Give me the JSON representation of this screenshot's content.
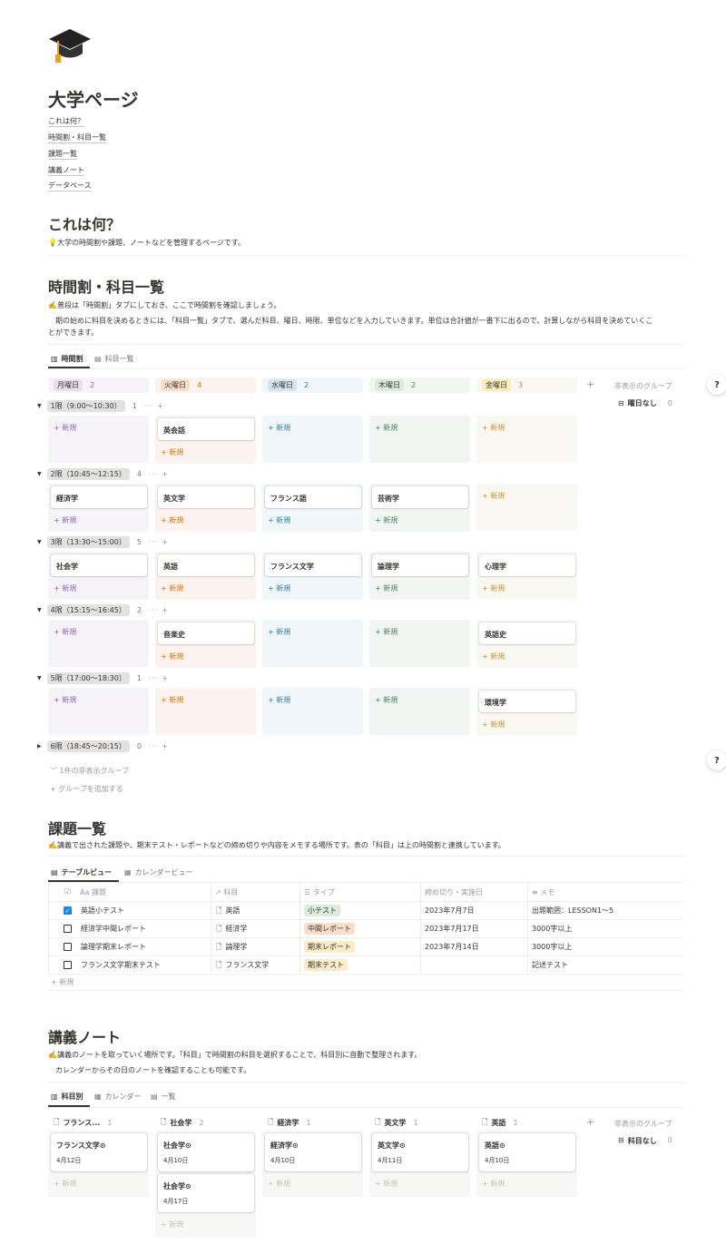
{
  "page": {
    "title": "大学ページ"
  },
  "toc": [
    "これは何？",
    "時間割・科目一覧",
    "課題一覧",
    "講義ノート",
    "データベース"
  ],
  "sec1": {
    "title": "これは何？",
    "text": "💡大学の時間割や課題、ノートなどを管理するページです。"
  },
  "sec2": {
    "title": "時間割・科目一覧",
    "text1": "✍️普段は「時間割」タブにしておき、ここで時間割を確認しましょう。",
    "text2": "期の始めに科目を決めるときには、「科目一覧」タブで、選んだ科目、曜日、時限、単位などを入力していきます。単位は合計値が一番下に出るので、計算しながら科目を決めていくこ",
    "text3": "とができます。",
    "tabs": [
      "時間割",
      "科目一覧"
    ]
  },
  "board": {
    "days": [
      {
        "label": "月曜日",
        "count": "2",
        "bg": "#f6f3f9",
        "tagbg": "#e8deee",
        "color": "#9065b0"
      },
      {
        "label": "火曜日",
        "count": "4",
        "bg": "#fbf3ef",
        "tagbg": "#fadec9",
        "color": "#d9730d"
      },
      {
        "label": "水曜日",
        "count": "2",
        "bg": "#f1f6fa",
        "tagbg": "#d3e5ef",
        "color": "#337ea9"
      },
      {
        "label": "木曜日",
        "count": "2",
        "bg": "#f2f6f3",
        "tagbg": "#dbeddb",
        "color": "#448361"
      },
      {
        "label": "金曜日",
        "count": "3",
        "bg": "#f9f8f2",
        "tagbg": "#fbeeb8",
        "color": "#cb912f"
      }
    ],
    "hidden_label": "非表示のグループ",
    "no_day": "曜日なし",
    "no_day_count": "0",
    "new_label": "+ 新規",
    "groups": [
      {
        "label": "1限（9:00〜10:30）",
        "count": "1",
        "cards": [
          "",
          "英会話",
          "",
          "",
          ""
        ]
      },
      {
        "label": "2限（10:45〜12:15）",
        "count": "4",
        "cards": [
          "経済学",
          "英文学",
          "フランス語",
          "芸術学",
          ""
        ]
      },
      {
        "label": "3限（13:30〜15:00）",
        "count": "5",
        "cards": [
          "社会学",
          "英語",
          "フランス文学",
          "論理学",
          "心理学"
        ]
      },
      {
        "label": "4限（15:15〜16:45）",
        "count": "2",
        "cards": [
          "",
          "音楽史",
          "",
          "",
          "英語史"
        ]
      },
      {
        "label": "5限（17:00〜18:30）",
        "count": "1",
        "cards": [
          "",
          "",
          "",
          "",
          "環境学"
        ]
      },
      {
        "label": "6限（18:45〜20:15）",
        "count": "0",
        "cards": []
      }
    ],
    "hidden_groups": "1件の非表示グループ",
    "add_group": "+ グループを追加する"
  },
  "sec3": {
    "title": "課題一覧",
    "text": "✍️講義で出された課題や、期末テスト・レポートなどの締め切りや内容をメモする場所です。表の「科目」は上の時間割と連携しています。",
    "tabs": [
      "テーブルビュー",
      "カレンダービュー"
    ],
    "headers": [
      "Aa 課題",
      "↗ 科目",
      "☰ タイプ",
      "締め切り・実施日",
      "≡ メモ"
    ],
    "rows": [
      {
        "done": true,
        "task": "英語小テスト",
        "subject": "英語",
        "type": "小テスト",
        "typebg": "#dbeddb",
        "date": "2023年7月7日",
        "memo": "出題範囲：LESSON1〜5"
      },
      {
        "done": false,
        "task": "経済学中間レポート",
        "subject": "経済学",
        "type": "中間レポート",
        "typebg": "#fadec9",
        "date": "2023年7月17日",
        "memo": "3000字以上"
      },
      {
        "done": false,
        "task": "論理学期末レポート",
        "subject": "論理学",
        "type": "期末レポート",
        "typebg": "#fdecc8",
        "date": "2023年7月14日",
        "memo": "3000字以上"
      },
      {
        "done": false,
        "task": "フランス文学期末テスト",
        "subject": "フランス文学",
        "type": "期末テスト",
        "typebg": "#fdecc8",
        "date": "",
        "memo": "記述テスト"
      }
    ],
    "new": "+ 新規"
  },
  "sec4": {
    "title": "講義ノート",
    "text1": "✍️講義のノートを取っていく場所です。「科目」で時間割の科目を選択することで、科目別に自動で整理されます。",
    "text2": "カレンダーからその日のノートを確認することも可能です。",
    "tabs": [
      "科目別",
      "カレンダー",
      "一覧"
    ],
    "cols": [
      {
        "label": "フランス...",
        "count": "1",
        "notes": [
          {
            "t": "フランス文学",
            "d": "4月12日"
          }
        ]
      },
      {
        "label": "社会学",
        "count": "2",
        "notes": [
          {
            "t": "社会学",
            "d": "4月10日"
          },
          {
            "t": "社会学",
            "d": "4月17日"
          }
        ]
      },
      {
        "label": "経済学",
        "count": "1",
        "notes": [
          {
            "t": "経済学",
            "d": "4月10日"
          }
        ]
      },
      {
        "label": "英文学",
        "count": "1",
        "notes": [
          {
            "t": "英文学",
            "d": "4月11日"
          }
        ]
      },
      {
        "label": "英語",
        "count": "1",
        "notes": [
          {
            "t": "英語",
            "d": "4月10日"
          }
        ]
      }
    ],
    "hidden_label": "非表示のグループ",
    "no_subject": "科目なし",
    "no_subject_count": "0",
    "new": "+ 新規"
  },
  "help": "?"
}
